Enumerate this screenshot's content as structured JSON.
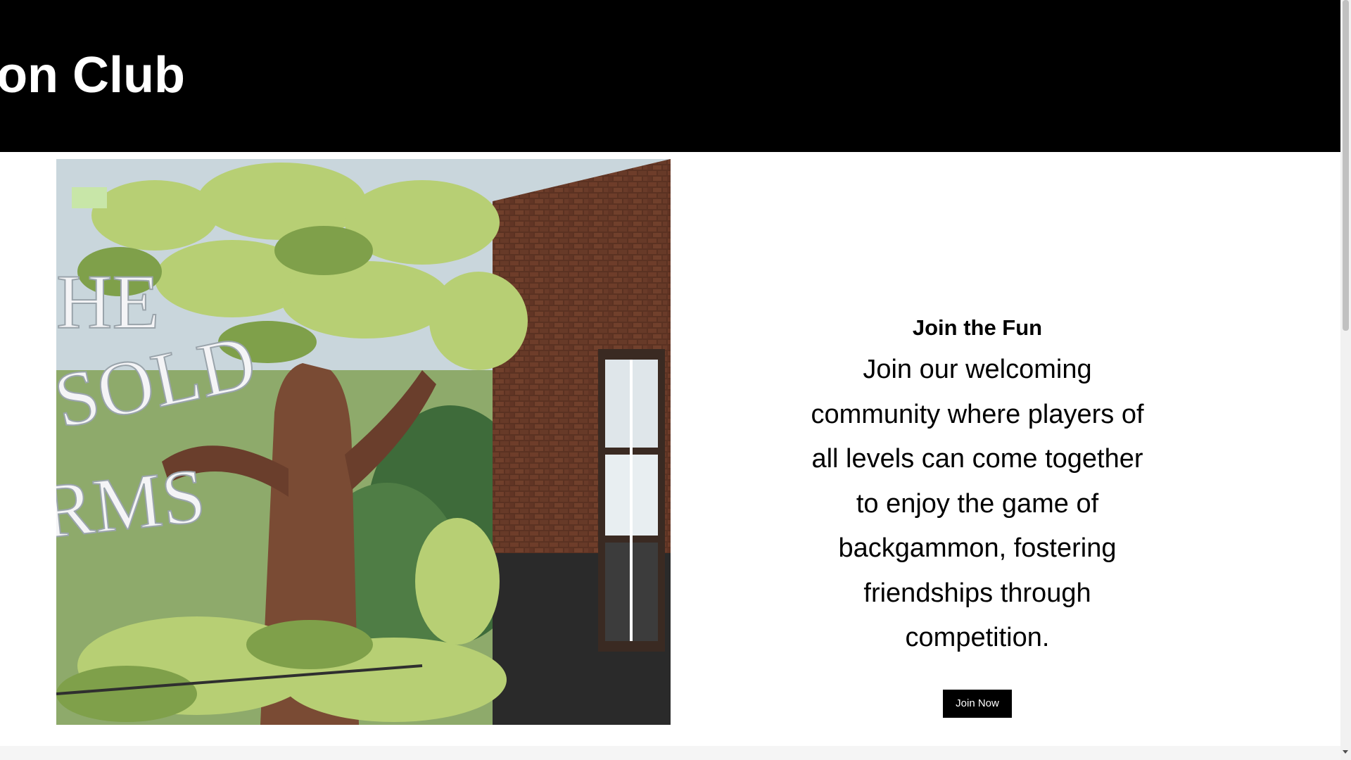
{
  "header": {
    "site_title": "Backgammon Club",
    "background_color": "#000000"
  },
  "hero": {
    "image_description_icon": "photo-icon",
    "painted_sign_text": "THE ... SOLD ... ARMS"
  },
  "section": {
    "heading": "Join the Fun",
    "body": "Join our welcoming community where players of all levels can come together to enjoy the game of backgammon, fostering friendships through competition.",
    "button_label": "Join Now",
    "button_color": "#000000"
  }
}
